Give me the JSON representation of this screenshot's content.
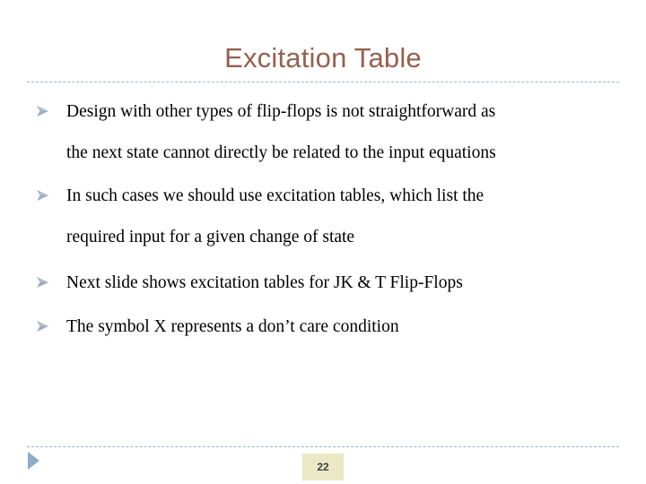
{
  "slide": {
    "title": "Excitation Table",
    "title_color": "#96604F",
    "background_color": "#FFFFFF",
    "body_text_color": "#000000",
    "rule_color": "#9FB3CC"
  },
  "bullets": [
    {
      "marker": "wingdings-arrow-bullet",
      "lines": [
        "Design with other types of flip-flops is not straightforward as",
        "the next state cannot directly be related to the input equations"
      ]
    },
    {
      "marker": "wingdings-arrow-bullet",
      "lines": [
        "In such cases we should use excitation tables, which list the",
        "required input for a given change of state"
      ]
    },
    {
      "marker": "wingdings-arrow-bullet",
      "lines": [
        "Next slide shows excitation tables for JK & T Flip-Flops"
      ]
    },
    {
      "marker": "wingdings-arrow-bullet",
      "lines": [
        "The symbol X represents a don’t care condition"
      ]
    }
  ],
  "footer": {
    "page_number": "22",
    "page_number_bg": "#E9E9C6",
    "page_number_color": "#3D3D3D",
    "arrow_icon": "play-triangle-icon",
    "arrow_color": "#8FAACB"
  }
}
